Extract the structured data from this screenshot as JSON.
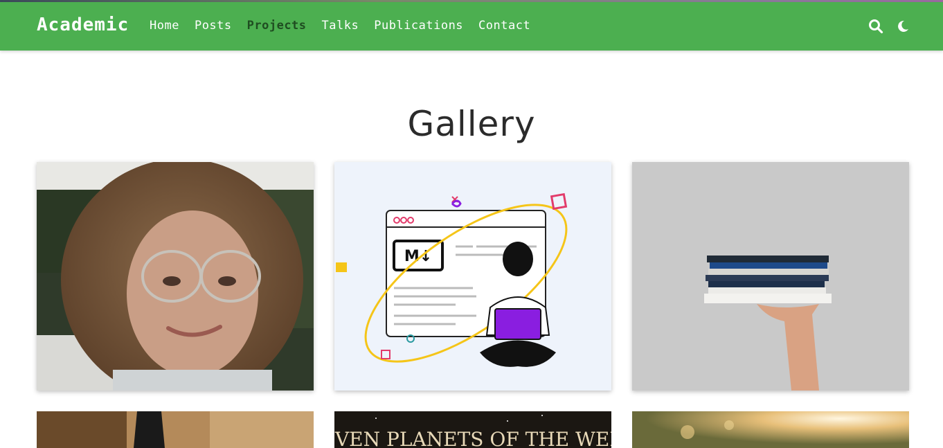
{
  "navbar": {
    "brand": "Academic",
    "links": [
      "Home",
      "Posts",
      "Projects",
      "Talks",
      "Publications",
      "Contact"
    ],
    "active": "Projects",
    "icons": [
      "search-icon",
      "moon-icon"
    ],
    "color": "#4caf50"
  },
  "page": {
    "title": "Gallery"
  },
  "gallery": {
    "tiles": [
      {
        "subject": "portrait-photo"
      },
      {
        "subject": "markdown-illustration",
        "badge": "M↓"
      },
      {
        "subject": "books-stack-photo"
      },
      {
        "subject": "black-object-photo"
      },
      {
        "subject": "planets-poster",
        "caption": "SEVEN PLANETS OF THE WEEK"
      },
      {
        "subject": "sunlight-bokeh-photo"
      }
    ]
  }
}
